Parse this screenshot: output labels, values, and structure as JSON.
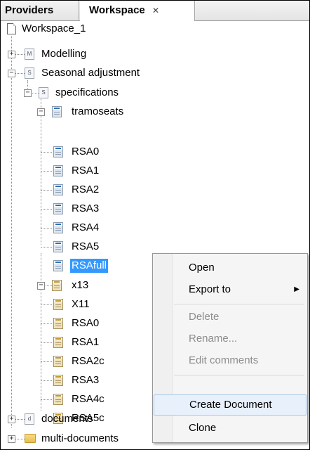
{
  "tabs": {
    "providers": "Providers",
    "workspace": "Workspace",
    "workspace_close": "✕"
  },
  "tree": {
    "workspace": "Workspace_1",
    "modelling": "Modelling",
    "modelling_icon": "M",
    "seasonal": "Seasonal adjustment",
    "seasonal_icon": "S",
    "specifications": "specifications",
    "specifications_icon": "S",
    "tramoseats": "tramoseats",
    "tramoseats_items": [
      "RSA0",
      "RSA1",
      "RSA2",
      "RSA3",
      "RSA4",
      "RSA5",
      "RSAfull"
    ],
    "x13": "x13",
    "x13_items": [
      "X11",
      "RSA0",
      "RSA1",
      "RSA2c",
      "RSA3",
      "RSA4c",
      "RSA5c"
    ],
    "documents": "documents",
    "documents_icon": "d",
    "multi_documents": "multi-documents"
  },
  "context_menu": {
    "open": "Open",
    "export_to": "Export to",
    "delete": "Delete",
    "rename": "Rename...",
    "edit_comments": "Edit comments",
    "create_document": "Create Document",
    "clone": "Clone",
    "submenu_arrow": "▶"
  },
  "colors": {
    "selection": "#3399ff",
    "menu_hover": "#e8f0fb"
  }
}
